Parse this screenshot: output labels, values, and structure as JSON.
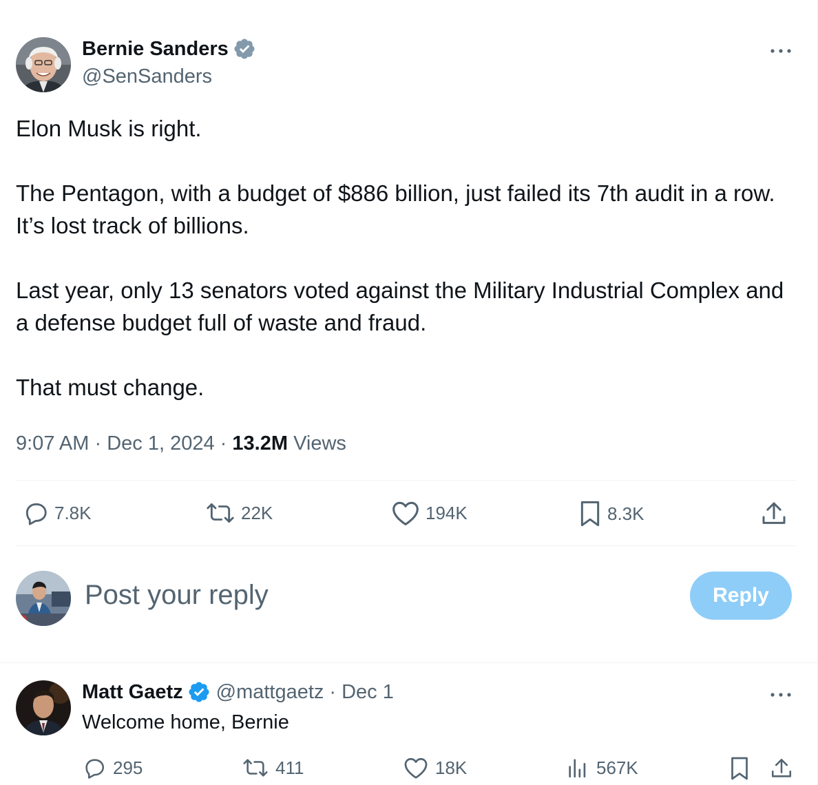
{
  "main_tweet": {
    "author_name": "Bernie Sanders",
    "author_handle": "@SenSanders",
    "paragraphs": [
      "Elon Musk is right.",
      "The Pentagon, with a budget of $886 billion, just failed its 7th audit in a row. It’s lost track of billions.",
      "Last year, only 13 senators voted against the Military Industrial Complex and a defense budget full of waste and fraud.",
      "That must change."
    ],
    "time": "9:07 AM",
    "sep": "·",
    "date": "Dec 1, 2024",
    "views_count": "13.2M",
    "views_label": "Views",
    "actions": {
      "replies": "7.8K",
      "reposts": "22K",
      "likes": "194K",
      "bookmarks": "8.3K"
    },
    "more_icon": "more-horizontal-icon",
    "verified_color": "#829aab"
  },
  "composer": {
    "placeholder": "Post your reply",
    "button_label": "Reply",
    "button_color": "#8ecdf8"
  },
  "reply_tweet": {
    "author_name": "Matt Gaetz",
    "author_handle": "@mattgaetz",
    "sep": "·",
    "date": "Dec 1",
    "text": "Welcome home, Bernie",
    "actions": {
      "replies": "295",
      "reposts": "411",
      "likes": "18K",
      "views": "567K"
    },
    "verified_color": "#1d9bf0"
  }
}
